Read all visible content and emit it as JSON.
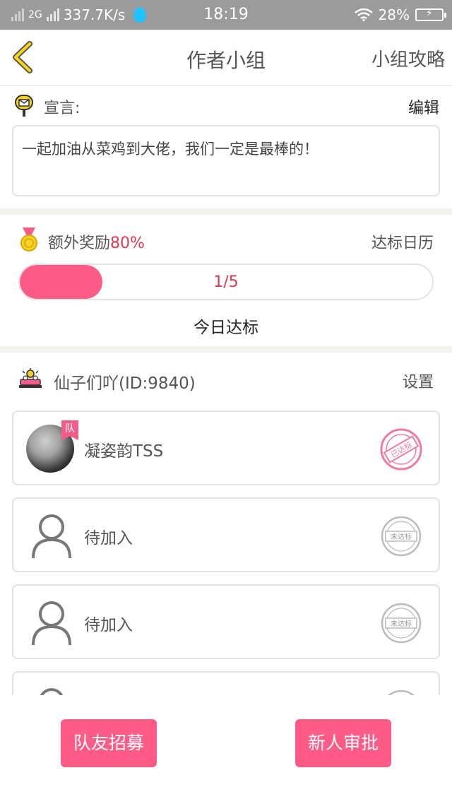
{
  "status_bar": {
    "network_type": "2G",
    "speed": "337.7K/s",
    "time": "18:19",
    "battery": "28%"
  },
  "nav": {
    "title": "作者小组",
    "guide": "小组攻略"
  },
  "manifesto": {
    "label": "宣言:",
    "edit": "编辑",
    "text": "一起加油从菜鸡到大佬，我们一定是最棒的！"
  },
  "reward": {
    "label": "额外奖励",
    "percent": "80%",
    "calendar": "达标日历",
    "progress_text": "1/5",
    "progress_fraction": 0.2,
    "today_label": "今日达标"
  },
  "team": {
    "name": "仙子们吖(ID:9840)",
    "settings": "设置",
    "captain_badge": "队",
    "members": [
      {
        "name": "凝姿韵TSS",
        "status": "已达标"
      },
      {
        "name": "待加入",
        "status": "未达标"
      },
      {
        "name": "待加入",
        "status": "未达标"
      },
      {
        "name": "",
        "status": ""
      }
    ]
  },
  "buttons": {
    "recruit": "队友招募",
    "approve": "新人审批"
  },
  "colors": {
    "accent": "#fe5c86",
    "highlight": "#e0384f",
    "status_bar": "#9b9b9b"
  }
}
